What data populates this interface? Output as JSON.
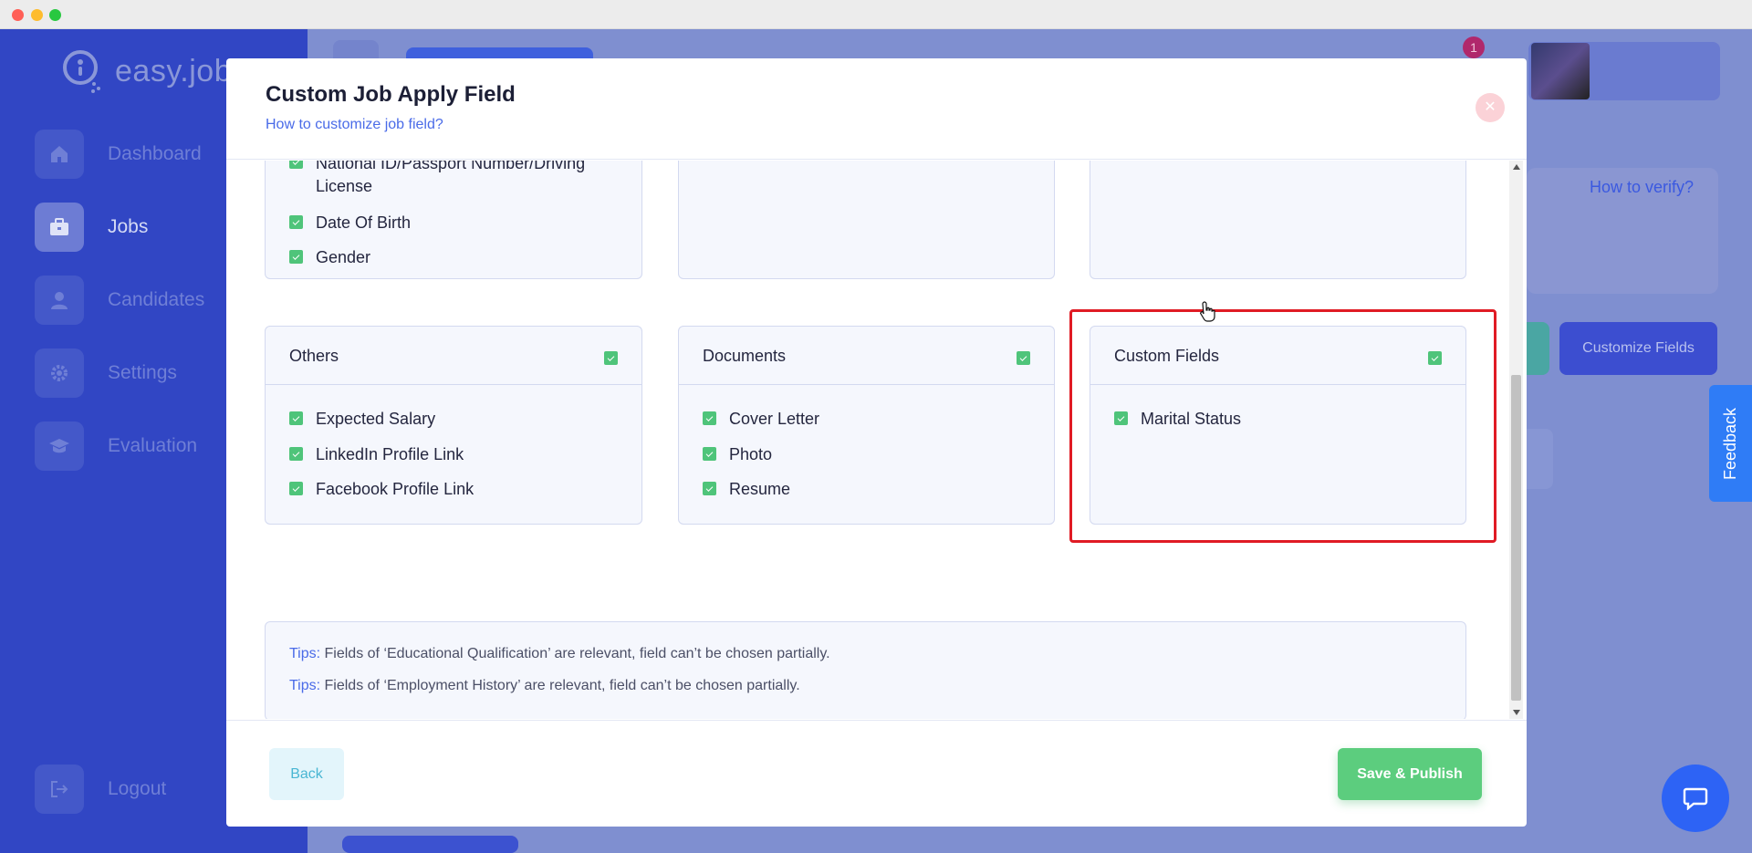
{
  "app": {
    "logo_text": "easy.jobs",
    "notification_count": "1",
    "verify_link": "How to verify?",
    "customize_fields_label": "Customize Fields",
    "feedback_label": "Feedback"
  },
  "sidebar": {
    "items": [
      {
        "label": "Dashboard",
        "icon": "home-icon"
      },
      {
        "label": "Jobs",
        "icon": "briefcase-icon",
        "active": true
      },
      {
        "label": "Candidates",
        "icon": "user-icon"
      },
      {
        "label": "Settings",
        "icon": "gear-icon"
      },
      {
        "label": "Evaluation",
        "icon": "graduation-cap-icon"
      }
    ],
    "logout_label": "Logout"
  },
  "modal": {
    "title": "Custom Job Apply Field",
    "help_link": "How to customize job field?",
    "top_fields": [
      {
        "label": "National ID/Passport Number/Driving License",
        "checked": true
      },
      {
        "label": "Date Of Birth",
        "checked": true
      },
      {
        "label": "Gender",
        "checked": true
      }
    ],
    "sections": [
      {
        "title": "Others",
        "checked": true,
        "fields": [
          {
            "label": "Expected Salary",
            "checked": true
          },
          {
            "label": "LinkedIn Profile Link",
            "checked": true
          },
          {
            "label": "Facebook Profile Link",
            "checked": true
          }
        ]
      },
      {
        "title": "Documents",
        "checked": true,
        "fields": [
          {
            "label": "Cover Letter",
            "checked": true
          },
          {
            "label": "Photo",
            "checked": true
          },
          {
            "label": "Resume",
            "checked": true
          }
        ]
      },
      {
        "title": "Custom Fields",
        "checked": true,
        "fields": [
          {
            "label": "Marital Status",
            "checked": true
          }
        ]
      }
    ],
    "tips": [
      {
        "key": "Tips:",
        "text": " Fields of ‘Educational Qualification’ are relevant, field can’t be chosen partially."
      },
      {
        "key": "Tips:",
        "text": " Fields of ‘Employment History’ are relevant, field can’t be chosen partially."
      }
    ],
    "back_label": "Back",
    "publish_label": "Save & Publish"
  },
  "colors": {
    "sidebar": "#3146c4",
    "accent": "#4a6be8",
    "check": "#4fc47a",
    "highlight": "#e01b24"
  }
}
